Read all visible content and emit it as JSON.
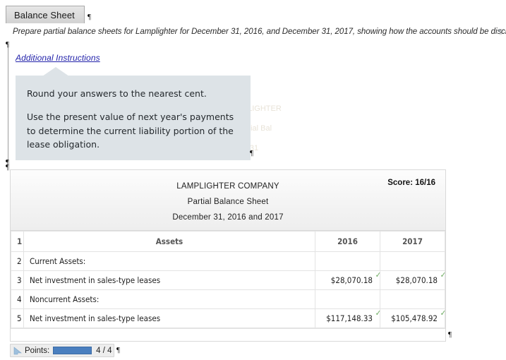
{
  "tab": {
    "label": "Balance Sheet"
  },
  "instructions": {
    "text": "Prepare partial balance sheets for Lamplighter for December 31, 2016, and December 31, 2017, showing how the accounts should be disclosed.",
    "additional_link": "Additional Instructions"
  },
  "callout": {
    "paragraphs": [
      "Round your answers to the nearest cent.",
      "Use the present value of next year's payments to determine the current liability portion of the lease obligation."
    ]
  },
  "watermark": {
    "lines": [
      "LAMPLIGHTER",
      "Partial Bal",
      "31"
    ]
  },
  "worksheet": {
    "company": "LAMPLIGHTER COMPANY",
    "statement": "Partial Balance Sheet",
    "period": "December 31, 2016 and 2017",
    "score": "Score: 16/16",
    "columns": [
      "Assets",
      "2016",
      "2017"
    ],
    "rows": [
      {
        "num": "1",
        "label": "Assets",
        "v2016": "2016",
        "v2017": "2017",
        "kind": "header",
        "tick2016": "",
        "tick2017": ""
      },
      {
        "num": "2",
        "label": "Current Assets:",
        "v2016": "",
        "v2017": "",
        "kind": "section",
        "tick2016": "",
        "tick2017": ""
      },
      {
        "num": "3",
        "label": "Net investment in sales-type leases",
        "v2016": "$28,070.18",
        "v2017": "$28,070.18",
        "kind": "data",
        "tick2016": "✓",
        "tick2017": "✓"
      },
      {
        "num": "4",
        "label": "Noncurrent Assets:",
        "v2016": "",
        "v2017": "",
        "kind": "section",
        "tick2016": "",
        "tick2017": ""
      },
      {
        "num": "5",
        "label": "Net investment in sales-type leases",
        "v2016": "$117,148.33",
        "v2017": "$105,478.92",
        "kind": "data",
        "tick2016": "✓",
        "tick2017": "✓"
      }
    ]
  },
  "points": {
    "label": "Points:",
    "value": "4 / 4",
    "fill_percent": 100,
    "bar_color": "#4a7fbf"
  },
  "marks": {
    "pilcrow": "¶"
  },
  "colors": {
    "callout_bg": "#dde3e7",
    "link": "#2222aa",
    "tick_green": "#67a85a",
    "meter_blue": "#4a7fbf"
  }
}
